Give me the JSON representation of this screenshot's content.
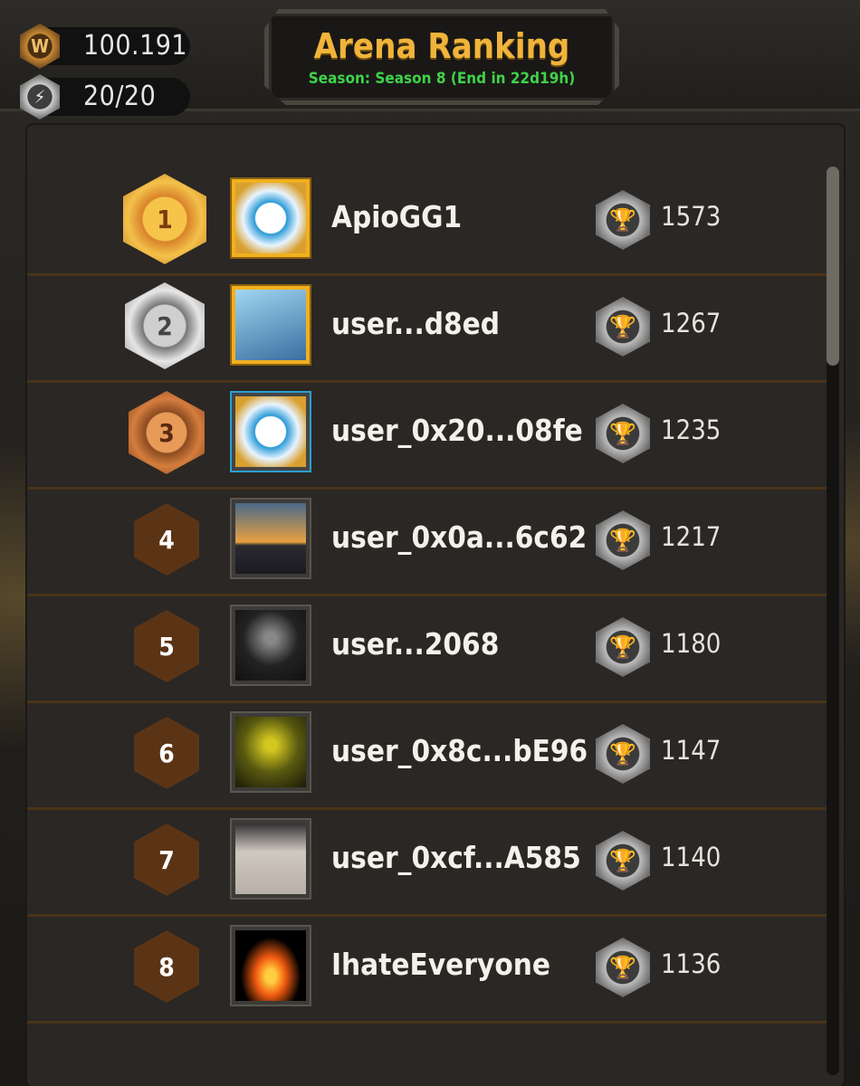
{
  "header": {
    "title": "Arena Ranking",
    "season": "Season: Season 8 (End in 22d19h)"
  },
  "currencies": [
    {
      "icon": "w-coin-icon",
      "letter": "W",
      "value": "100.191"
    },
    {
      "icon": "energy-icon",
      "letter": "⚡",
      "value": "20/20"
    }
  ],
  "rankings": [
    {
      "rank": "1",
      "name": "ApioGG1",
      "score": "1573",
      "badge": "gold",
      "avatar": "guild-logo-avatar"
    },
    {
      "rank": "2",
      "name": "user...d8ed",
      "score": "1267",
      "badge": "silver",
      "avatar": "person-photo-avatar"
    },
    {
      "rank": "3",
      "name": "user_0x20...08fe",
      "score": "1235",
      "badge": "bronze",
      "avatar": "guild-logo-avatar"
    },
    {
      "rank": "4",
      "name": "user_0x0a...6c62",
      "score": "1217",
      "badge": "plain",
      "avatar": "sunset-avatar"
    },
    {
      "rank": "5",
      "name": "user...2068",
      "score": "1180",
      "badge": "plain",
      "avatar": "skeleton-avatar"
    },
    {
      "rank": "6",
      "name": "user_0x8c...bE96",
      "score": "1147",
      "badge": "plain",
      "avatar": "knight-avatar"
    },
    {
      "rank": "7",
      "name": "user_0xcf...A585",
      "score": "1140",
      "badge": "plain",
      "avatar": "cat-meme-avatar"
    },
    {
      "rank": "8",
      "name": "IhateEveryone",
      "score": "1136",
      "badge": "plain",
      "avatar": "fire-avatar"
    }
  ],
  "colors": {
    "title": "#f0b43a",
    "season": "#3fd24a",
    "divider": "#4a3317"
  }
}
